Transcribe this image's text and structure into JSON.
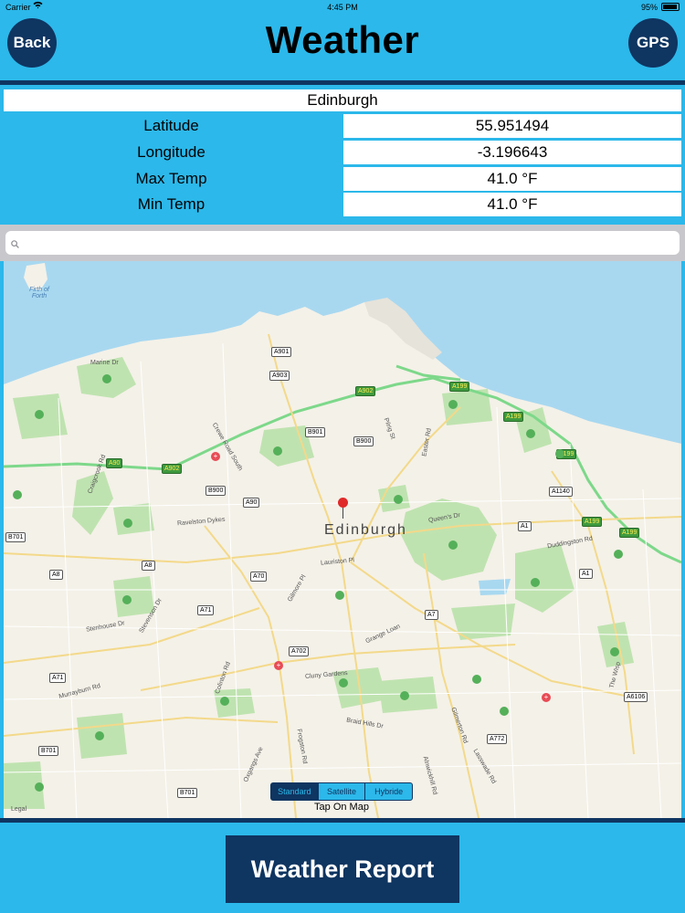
{
  "status_bar": {
    "carrier": "Carrier",
    "time": "4:45 PM",
    "battery": "95%"
  },
  "nav": {
    "back_label": "Back",
    "title": "Weather",
    "gps_label": "GPS"
  },
  "city": "Edinburgh",
  "info": [
    {
      "label": "Latitude",
      "value": "55.951494"
    },
    {
      "label": "Longitude",
      "value": "-3.196643"
    },
    {
      "label": "Max Temp",
      "value": "41.0 °F"
    },
    {
      "label": "Min Temp",
      "value": "41.0 °F"
    }
  ],
  "search": {
    "placeholder": ""
  },
  "map": {
    "city_label": "Edinburgh",
    "water_label": "Firth of Forth",
    "legal": "Legal",
    "road_labels": {
      "a901": "A901",
      "a903": "A903",
      "a902_1": "A902",
      "a902_2": "A902",
      "a90_1": "A90",
      "a199_1": "A199",
      "a199_2": "A199",
      "a199_3": "A199",
      "a199_4": "A199",
      "a199_5": "A199",
      "b901": "B901",
      "b900_1": "B900",
      "b900_2": "B900",
      "a90_2": "A90",
      "a1140": "A1140",
      "a1_1": "A1",
      "a1_2": "A1",
      "b701_1": "B701",
      "a8_1": "A8",
      "a8_2": "A8",
      "a70": "A70",
      "a71_1": "A71",
      "a71_2": "A71",
      "a7": "A7",
      "a702": "A702",
      "a6106": "A6106",
      "a772": "A772",
      "b701_2": "B701",
      "b701_3": "B701"
    },
    "streets": {
      "marine_dr": "Marine Dr",
      "craigcrook_rd": "Craigcrook Rd",
      "crewe_road_south": "Crewe Road South",
      "pilrig_st": "Pilrig St",
      "easter_rd": "Easter Rd",
      "ravelston_dykes": "Ravelston Dykes",
      "queens_dr": "Queen's Dr",
      "duddingston_rd": "Duddingston Rd",
      "lauriston_pl": "Lauriston Pl",
      "gilmore_pl": "Gilmore Pl",
      "stenhouse_dr": "Stenhouse Dr",
      "stevenson_dr": "Stevenson Dr",
      "grange_loan": "Grange Loan",
      "colinton_rd": "Colinton Rd",
      "murrayburn_rd": "Murrayburn Rd",
      "cluny_gardens": "Cluny Gardens",
      "braid_hills_dr": "Braid Hills Dr",
      "oxgangs_ave": "Oxgangs Ave",
      "frogston_rd": "Frogston Rd",
      "alnwickhill_rd": "Alnwickhill Rd",
      "lasswade_rd": "Lasswade Rd",
      "the_wisp": "The Wisp",
      "gilmerton_rd": "Gilmerton Rd"
    },
    "map_types": [
      "Standard",
      "Satellite",
      "Hybride"
    ],
    "selected_map_type": "Standard",
    "tap_label": "Tap On Map"
  },
  "report_button": "Weather Report",
  "colors": {
    "background": "#2cb8ea",
    "dark_accent": "#0f3561",
    "water": "#a8d8f0",
    "park": "#bfe3b0",
    "land": "#f4f1e8",
    "highway": "#7dd88a"
  }
}
